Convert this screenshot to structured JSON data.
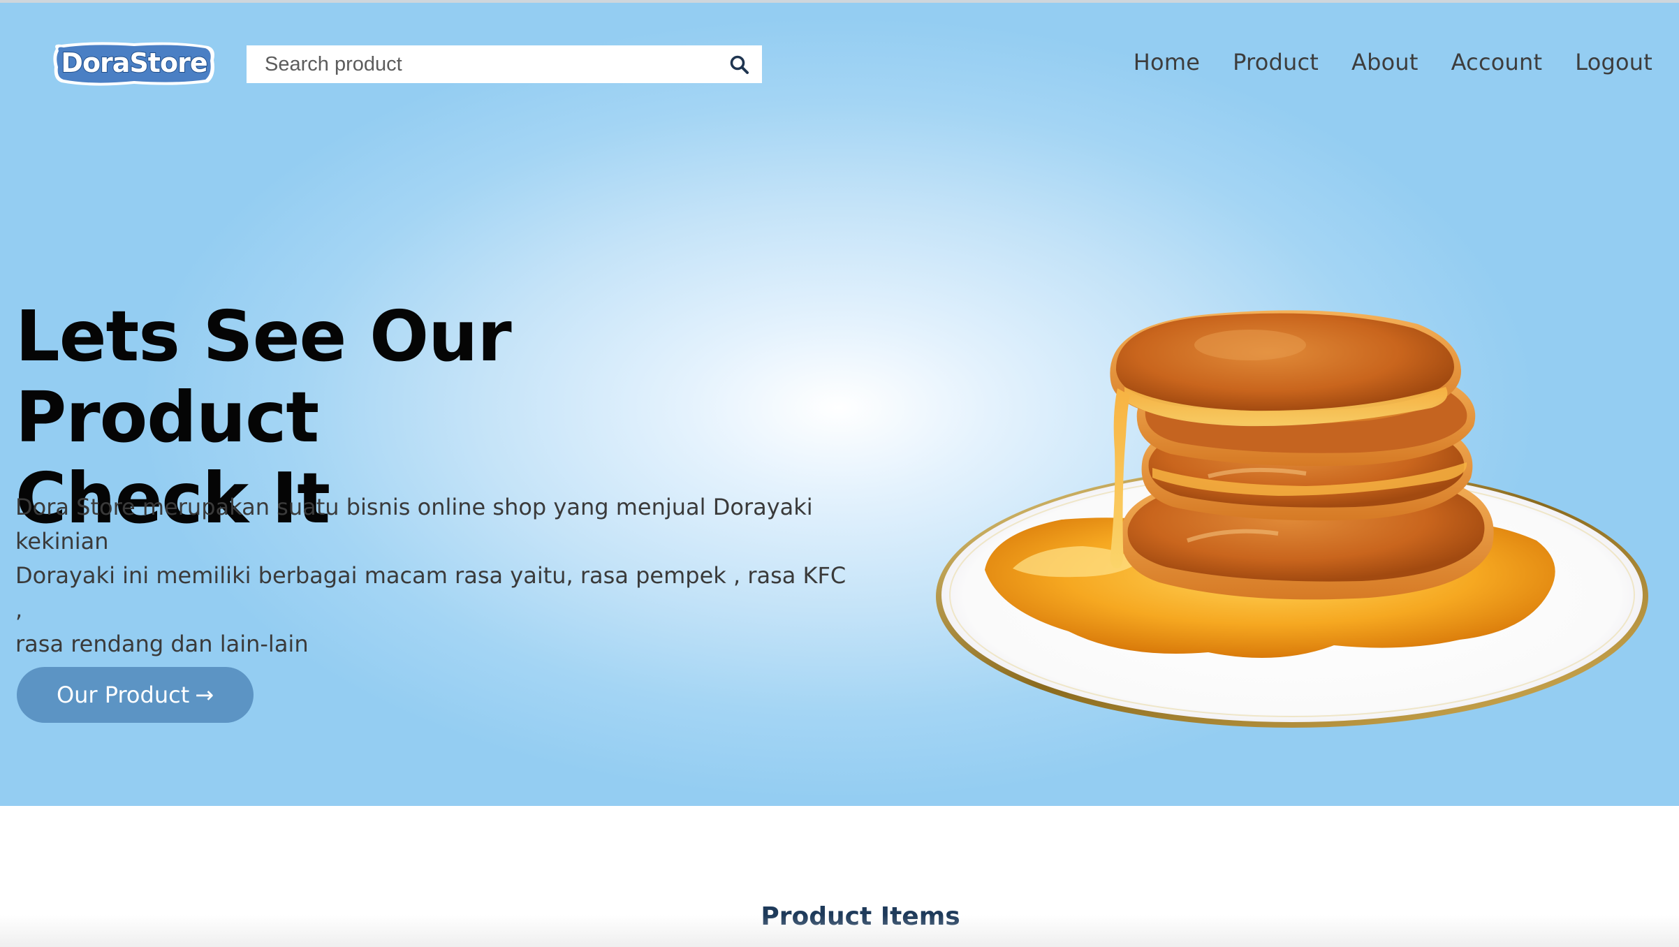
{
  "brand": {
    "logo_text": "DoraStore"
  },
  "search": {
    "placeholder": "Search product",
    "value": "",
    "icon": "search-icon"
  },
  "nav": {
    "items": [
      {
        "label": "Home"
      },
      {
        "label": "Product"
      },
      {
        "label": "About"
      },
      {
        "label": "Account"
      },
      {
        "label": "Logout"
      }
    ]
  },
  "hero": {
    "headline_line1": "Lets See Our Product",
    "headline_line2": "Check It",
    "desc_line1": "Dora Store merupakan suatu bisnis online shop yang menjual Dorayaki",
    "desc_line2": "kekinian",
    "desc_line3": "Dorayaki ini memiliki berbagai macam rasa yaitu, rasa pempek , rasa KFC ,",
    "desc_line4": "rasa rendang dan lain-lain",
    "cta_label": "Our Product",
    "cta_arrow": "→",
    "image": "dorayaki-stack-with-syrup-on-plate"
  },
  "products": {
    "title": "Product Items"
  },
  "colors": {
    "hero_bg_edge": "#94cdf2",
    "hero_bg_center": "#ffffff",
    "cta_bg": "#5c94c4",
    "section_title": "#1e3a5a",
    "logo_blue": "#3d6fb6"
  }
}
